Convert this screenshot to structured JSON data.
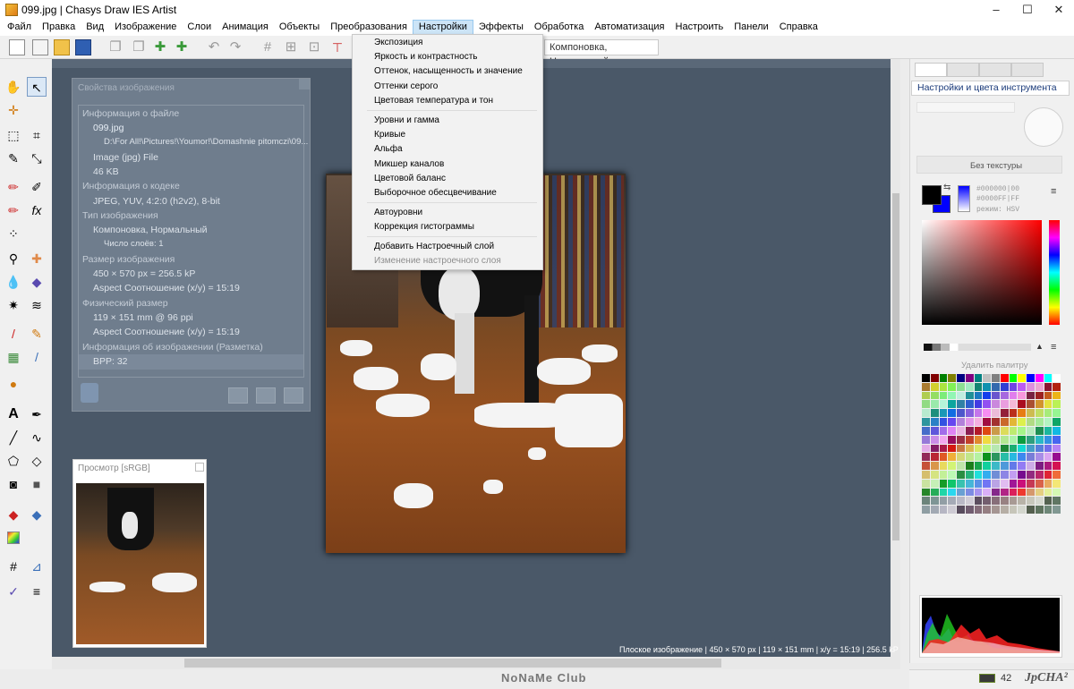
{
  "window": {
    "title": "099.jpg | Chasys Draw IES Artist",
    "minimize": "–",
    "maximize": "☐",
    "close": "✕"
  },
  "menu": [
    "Файл",
    "Правка",
    "Вид",
    "Изображение",
    "Слои",
    "Анимация",
    "Объекты",
    "Преобразования",
    "Настройки",
    "Эффекты",
    "Обработка",
    "Автоматизация",
    "Настроить",
    "Панели",
    "Справка"
  ],
  "menu_active": "Настройки",
  "toolbar": {
    "layer_mode_field": "Компоновка, Нормальный"
  },
  "adjust_menu": {
    "items": [
      "Экспозиция",
      "Яркость и контрастность",
      "Оттенок, насыщенность и значение",
      "Оттенки серого",
      "Цветовая температура и тон",
      "Уровни и гамма",
      "Кривые",
      "Альфа",
      "Микшер каналов",
      "Цветовой баланс",
      "Выборочное обесцвечивание",
      "Автоуровни",
      "Коррекция гистограммы",
      "Добавить Настроечный слой",
      "Изменение настроечного слоя"
    ],
    "disabled_item": "Изменение настроечного слоя"
  },
  "props_panel": {
    "title": "Свойства изображения",
    "rows": [
      {
        "text": "Информация о файле",
        "kind": "header"
      },
      {
        "text": "099.jpg",
        "kind": "link"
      },
      {
        "text": "D:\\For All!\\Pictures!\\Youmor!\\Domashnie pitomczi\\09...",
        "kind": "path"
      },
      {
        "text": "Image (jpg) File",
        "kind": "value"
      },
      {
        "text": "46 KB",
        "kind": "value"
      },
      {
        "text": "Информация о кодеке",
        "kind": "header"
      },
      {
        "text": "JPEG, YUV, 4:2:0 (h2v2), 8-bit",
        "kind": "value"
      },
      {
        "text": "Тип изображения",
        "kind": "header"
      },
      {
        "text": "Компоновка, Нормальный",
        "kind": "value"
      },
      {
        "text": "Число слоёв: 1",
        "kind": "path"
      },
      {
        "text": "Размер изображения",
        "kind": "header"
      },
      {
        "text": "450 × 570 px = 256.5 kP",
        "kind": "value"
      },
      {
        "text": "Aspect Соотношение (x/y) = 15:19",
        "kind": "value"
      },
      {
        "text": "Физический размер",
        "kind": "header"
      },
      {
        "text": "119 × 151 mm @ 96 ppi",
        "kind": "value"
      },
      {
        "text": "Aspect Соотношение (x/y) = 15:19",
        "kind": "value"
      },
      {
        "text": "Информация об изображении (Разметка)",
        "kind": "header"
      },
      {
        "text": "BPP: 32",
        "kind": "value"
      }
    ]
  },
  "preview_panel": {
    "title": "Просмотр [sRGB]"
  },
  "canvas_status": "Плоское изображение | 450 × 570 px | 119 × 151 mm | x/y = 15:19 | 256.5 kP",
  "right_panel": {
    "title": "Настройки и цвета инструмента",
    "texture_label": "Без текстуры",
    "fg_hex": "#000000|00",
    "bg_hex": "#0000FF|FF",
    "mode_label": "режим: HSV",
    "delete_palette": "Удалить палитру",
    "colors": {
      "foreground": "#000000",
      "background": "#0000ff"
    }
  },
  "status": {
    "memory": "42",
    "logo": "JpCHA²"
  },
  "watermark": "NoNaMe Club"
}
